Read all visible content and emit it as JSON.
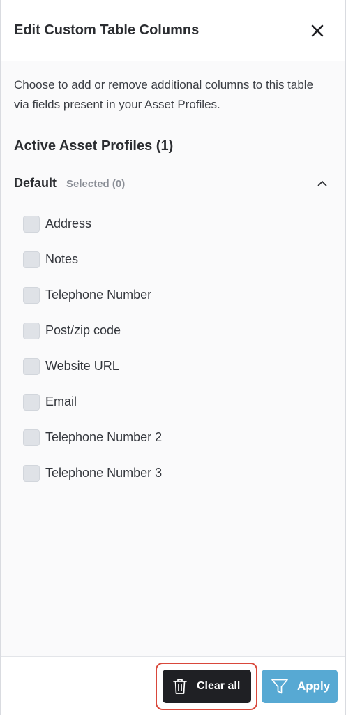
{
  "header": {
    "title": "Edit Custom Table Columns",
    "close_icon": "close-icon"
  },
  "description": "Choose to add or remove additional columns to this table via fields present in your Asset Profiles.",
  "section": {
    "title": "Active Asset Profiles (1)"
  },
  "group": {
    "name": "Default",
    "selected": "Selected (0)",
    "expanded": true,
    "chevron_icon": "chevron-up-icon"
  },
  "fields": [
    {
      "label": "Address",
      "checked": false
    },
    {
      "label": "Notes",
      "checked": false
    },
    {
      "label": "Telephone Number",
      "checked": false
    },
    {
      "label": "Post/zip code",
      "checked": false
    },
    {
      "label": "Website URL",
      "checked": false
    },
    {
      "label": "Email",
      "checked": false
    },
    {
      "label": "Telephone Number 2",
      "checked": false
    },
    {
      "label": "Telephone Number 3",
      "checked": false
    }
  ],
  "footer": {
    "clear_label": "Clear all",
    "clear_icon": "trash-icon",
    "apply_label": "Apply",
    "apply_icon": "filter-icon"
  },
  "colors": {
    "clear_button": "#1f2024",
    "apply_button": "#57a9d3",
    "highlight": "#d9483b"
  }
}
